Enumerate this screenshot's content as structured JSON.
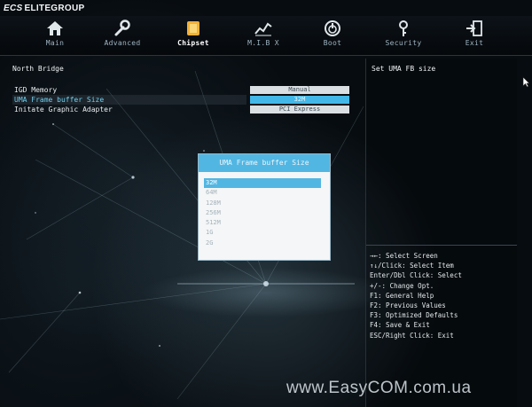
{
  "brand": {
    "mark": "ECS",
    "name": "ELITEGROUP"
  },
  "nav": [
    {
      "label": "Main",
      "icon": "home-icon",
      "active": false
    },
    {
      "label": "Advanced",
      "icon": "wrench-icon",
      "active": false
    },
    {
      "label": "Chipset",
      "icon": "chip-icon",
      "active": true
    },
    {
      "label": "M.I.B X",
      "icon": "graph-icon",
      "active": false
    },
    {
      "label": "Boot",
      "icon": "power-icon",
      "active": false
    },
    {
      "label": "Security",
      "icon": "key-icon",
      "active": false
    },
    {
      "label": "Exit",
      "icon": "exit-icon",
      "active": false
    }
  ],
  "panel": {
    "title": "North Bridge",
    "rows": [
      {
        "label": "IGD Memory",
        "value": "Manual"
      },
      {
        "label": "UMA Frame buffer Size",
        "value": "32M"
      },
      {
        "label": "Initate Graphic Adapter",
        "value": "PCI Express"
      }
    ]
  },
  "help": {
    "title": "Set UMA FB size",
    "lines": [
      "→←: Select Screen",
      "↑↓/Click: Select Item",
      "Enter/Dbl Click: Select",
      "+/-: Change Opt.",
      "F1: General Help",
      "F2: Previous Values",
      "F3: Optimized Defaults",
      "F4: Save & Exit",
      "ESC/Right Click: Exit"
    ]
  },
  "popup": {
    "title": "UMA Frame buffer Size",
    "options": [
      "32M",
      "64M",
      "128M",
      "256M",
      "512M",
      "1G",
      "2G"
    ],
    "selected_index": 0
  },
  "watermark": "www.EasyCOM.com.ua",
  "colors": {
    "accent": "#52b6e2",
    "highlight_text": "#6fd0ef",
    "value_box": "#d9dfe3"
  }
}
